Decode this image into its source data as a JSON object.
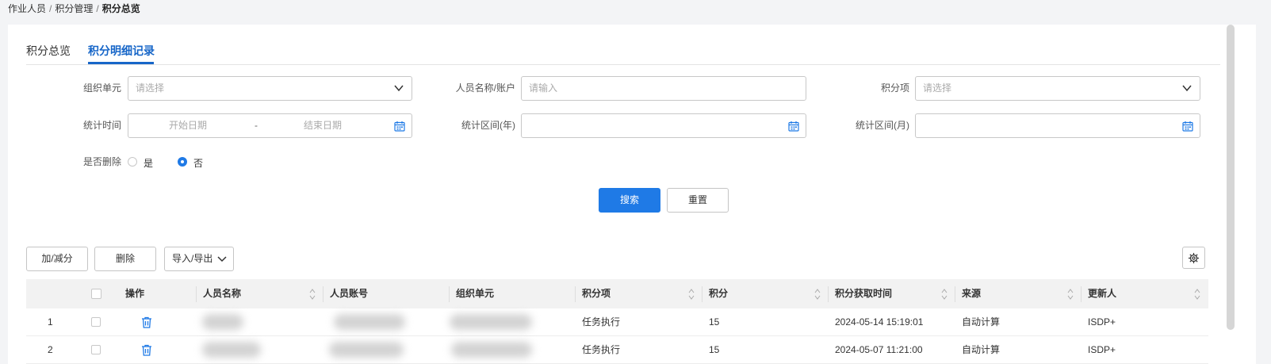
{
  "breadcrumb": {
    "level1": "作业人员",
    "level2": "积分管理",
    "level3": "积分总览",
    "sep": "/"
  },
  "tabs": [
    {
      "label": "积分总览"
    },
    {
      "label": "积分明细记录"
    }
  ],
  "filters": {
    "org_unit": {
      "label": "组织单元",
      "placeholder": "请选择"
    },
    "person": {
      "label": "人员名称/账户",
      "placeholder": "请输入"
    },
    "score_item": {
      "label": "积分项",
      "placeholder": "请选择"
    },
    "stat_time": {
      "label": "统计时间",
      "start_placeholder": "开始日期",
      "dash": "-",
      "end_placeholder": "结束日期"
    },
    "stat_year": {
      "label": "统计区间(年)"
    },
    "stat_month": {
      "label": "统计区间(月)"
    },
    "deleted": {
      "label": "是否删除",
      "options": [
        "是",
        "否"
      ],
      "selected": "否"
    }
  },
  "buttons": {
    "search": "搜索",
    "reset": "重置",
    "add_reduce": "加/减分",
    "delete": "删除",
    "import_export": "导入/导出"
  },
  "table": {
    "headers": {
      "action": "操作",
      "name": "人员名称",
      "account": "人员账号",
      "org": "组织单元",
      "item": "积分项",
      "score": "积分",
      "time": "积分获取时间",
      "source": "来源",
      "updater": "更新人"
    },
    "rows": [
      {
        "index": "1",
        "item": "任务执行",
        "score": "15",
        "time": "2024-05-14 15:19:01",
        "source": "自动计算",
        "updater": "ISDP+"
      },
      {
        "index": "2",
        "item": "任务执行",
        "score": "15",
        "time": "2024-05-07 11:21:00",
        "source": "自动计算",
        "updater": "ISDP+"
      }
    ]
  },
  "colors": {
    "primary": "#1f7ae6",
    "tab_active": "#1766c8"
  }
}
